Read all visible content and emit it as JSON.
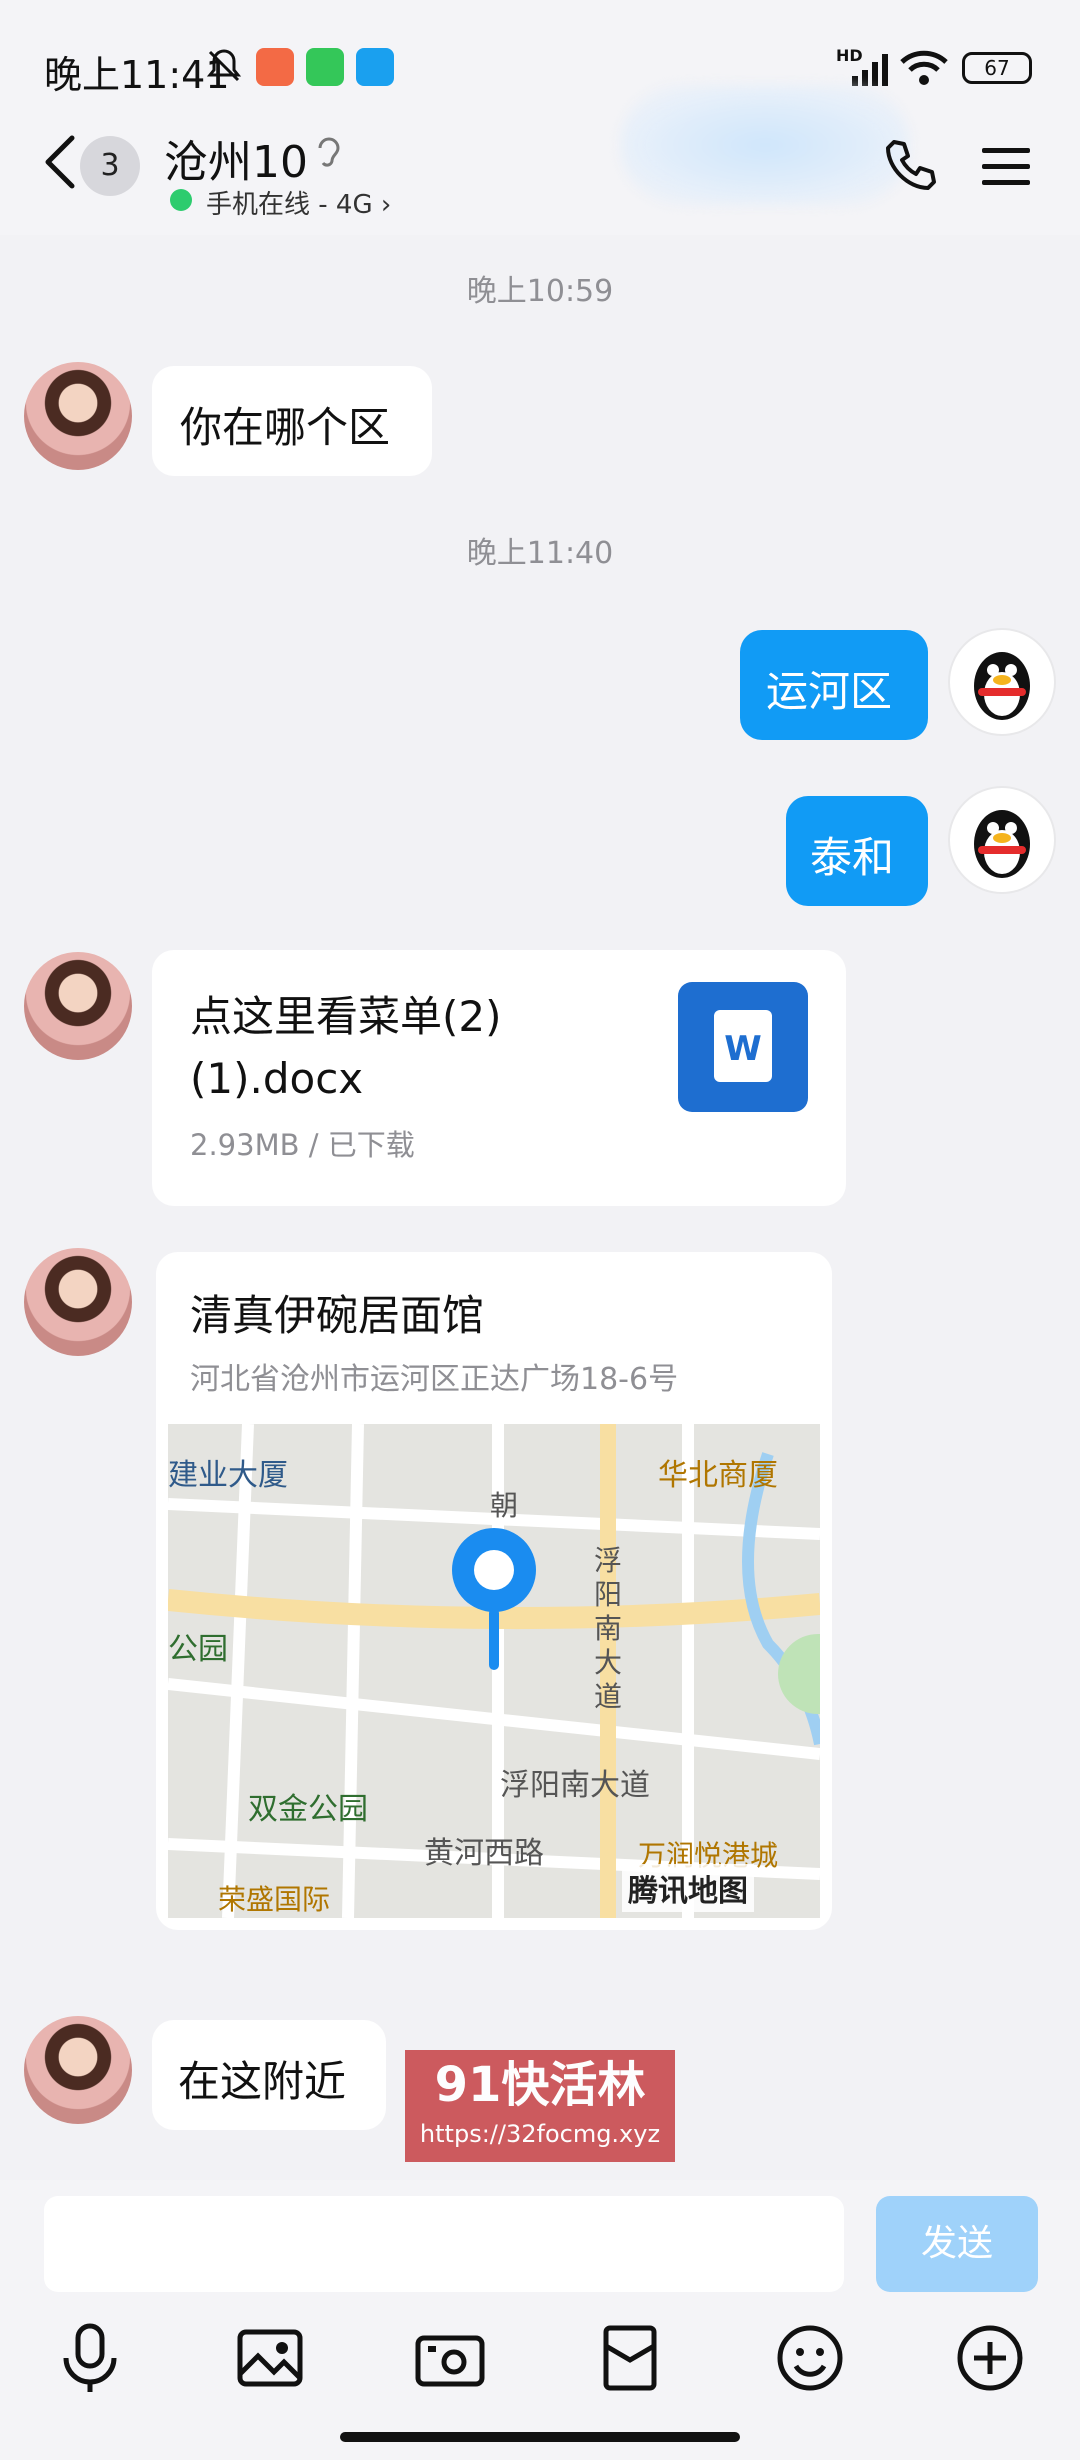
{
  "status_bar": {
    "time": "晚上11:41",
    "battery": "67",
    "network": "HD"
  },
  "header": {
    "unread_count": "3",
    "contact_name": "沧州10",
    "online_status": "手机在线 - 4G"
  },
  "chat": {
    "timestamp_1": "晚上10:59",
    "msg_1": "你在哪个区",
    "timestamp_2": "晚上11:40",
    "msg_2": "运河区",
    "msg_3": "泰和",
    "file": {
      "name_line1": "点这里看菜单(2)",
      "name_line2": "(1).docx",
      "meta": "2.93MB / 已下载",
      "icon_letter": "W"
    },
    "location": {
      "name": "清真伊碗居面馆",
      "address": "河北省沧州市运河区正达广场18-6号",
      "map_labels": {
        "building_1": "建业大厦",
        "building_2": "华北商厦",
        "road_1": "朝",
        "road_2": "阳",
        "road_vert": "浮阳南大道",
        "park_1": "公园",
        "park_2": "双金公园",
        "road_h": "浮阳南大道",
        "road_h2": "黄河西路",
        "poi_1": "万润悦港城",
        "poi_2": "荣盛国际",
        "map_brand": "腾讯地图"
      }
    },
    "msg_4": "在这附近"
  },
  "watermark": {
    "line1": "91快活林",
    "line2": "https://32focmg.xyz"
  },
  "input": {
    "placeholder": "",
    "send_label": "发送"
  },
  "colors": {
    "accent": "#119bf5",
    "send_disabled": "#9fd2fa",
    "online_dot": "#2dcc6e",
    "word_icon": "#1e6ed0"
  }
}
